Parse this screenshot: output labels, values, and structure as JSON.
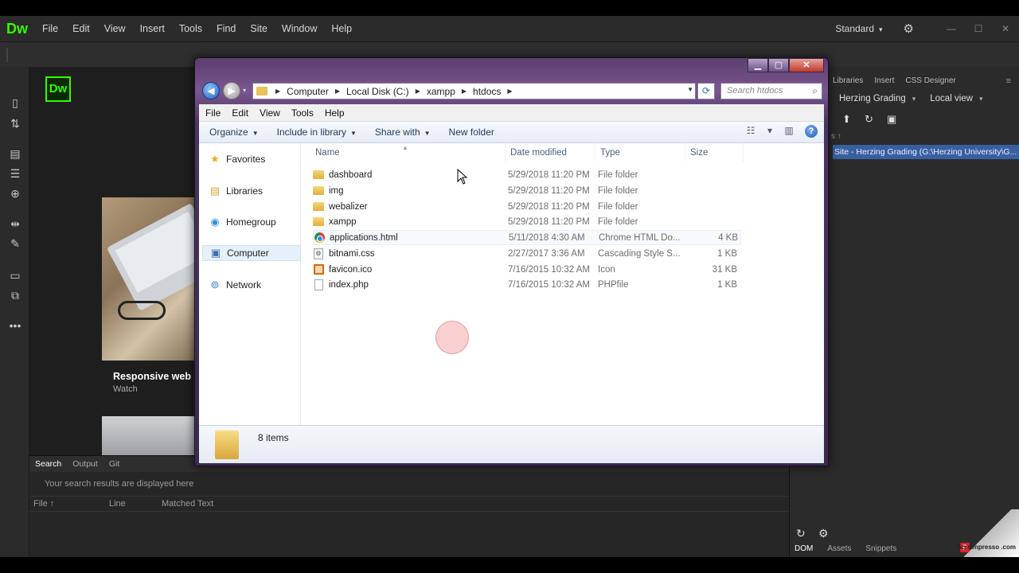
{
  "dw": {
    "logo": "Dw",
    "menu": [
      "File",
      "Edit",
      "View",
      "Insert",
      "Tools",
      "Find",
      "Site",
      "Window",
      "Help"
    ],
    "workspace": "Standard",
    "start_logo": "Dw",
    "card_title": "Responsive web de",
    "card_sub": "Watch",
    "bottom_tabs": [
      "Search",
      "Output",
      "Git"
    ],
    "search_message": "Your search results are displayed here",
    "result_columns": [
      "File ↑",
      "Line",
      "Matched Text"
    ],
    "right_tabs": [
      "Libraries",
      "Insert",
      "CSS Designer"
    ],
    "site_select": "Herzing Grading",
    "view_select": "Local view",
    "site_label": "s ↑",
    "site_row": "Site - Herzing Grading (G:\\Herzing University\\G...",
    "panel_bottom_tabs": [
      "DOM",
      "Assets",
      "Snippets"
    ],
    "watermark": "Screenpresso\n.com"
  },
  "explorer": {
    "breadcrumbs": [
      "Computer",
      "Local Disk (C:)",
      "xampp",
      "htdocs"
    ],
    "search_placeholder": "Search htdocs",
    "menu": [
      "File",
      "Edit",
      "View",
      "Tools",
      "Help"
    ],
    "commands": {
      "organize": "Organize",
      "include": "Include in library",
      "share": "Share with",
      "new_folder": "New folder"
    },
    "nav": [
      {
        "label": "Favorites",
        "icon": "star-icon"
      },
      {
        "label": "Libraries",
        "icon": "libraries-icon"
      },
      {
        "label": "Homegroup",
        "icon": "homegroup-icon"
      },
      {
        "label": "Computer",
        "icon": "computer-icon"
      },
      {
        "label": "Network",
        "icon": "network-icon"
      }
    ],
    "columns": [
      "Name",
      "Date modified",
      "Type",
      "Size"
    ],
    "files": [
      {
        "name": "dashboard",
        "date": "5/29/2018 11:20 PM",
        "type": "File folder",
        "size": "",
        "icon": "folder-icon"
      },
      {
        "name": "img",
        "date": "5/29/2018 11:20 PM",
        "type": "File folder",
        "size": "",
        "icon": "folder-icon"
      },
      {
        "name": "webalizer",
        "date": "5/29/2018 11:20 PM",
        "type": "File folder",
        "size": "",
        "icon": "folder-icon"
      },
      {
        "name": "xampp",
        "date": "5/29/2018 11:20 PM",
        "type": "File folder",
        "size": "",
        "icon": "folder-icon"
      },
      {
        "name": "applications.html",
        "date": "5/11/2018 4:30 AM",
        "type": "Chrome HTML Do...",
        "size": "4 KB",
        "icon": "chrome-icon"
      },
      {
        "name": "bitnami.css",
        "date": "2/27/2017 3:36 AM",
        "type": "Cascading Style S...",
        "size": "1 KB",
        "icon": "css-file-icon"
      },
      {
        "name": "favicon.ico",
        "date": "7/16/2015 10:32 AM",
        "type": "Icon",
        "size": "31 KB",
        "icon": "ico-file-icon"
      },
      {
        "name": "index.php",
        "date": "7/16/2015 10:32 AM",
        "type": "PHPfile",
        "size": "1 KB",
        "icon": "php-file-icon"
      }
    ],
    "status": "8 items"
  }
}
